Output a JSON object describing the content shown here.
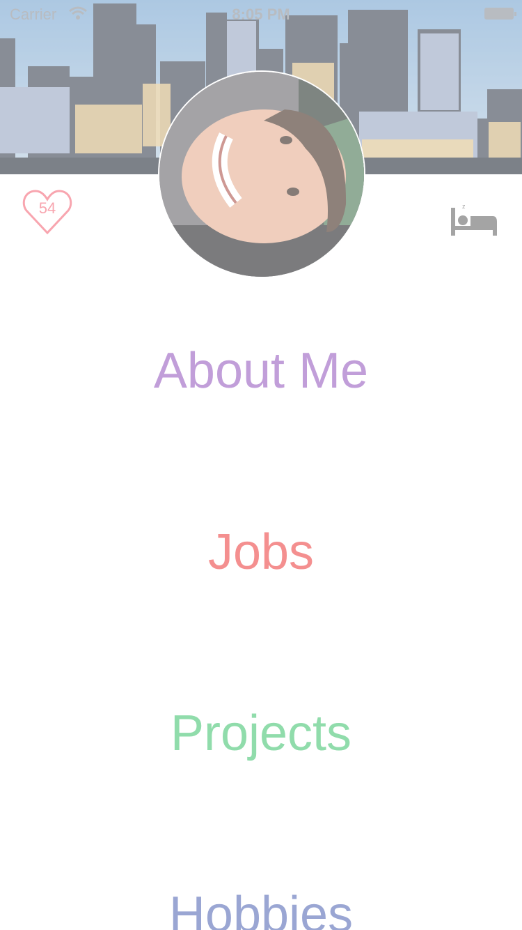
{
  "status_bar": {
    "carrier": "Carrier",
    "time": "8:05 PM"
  },
  "profile": {
    "like_count": "54",
    "like_color": "#f46f7e"
  },
  "menu": {
    "items": [
      {
        "label": "About Me",
        "color": "#9b63c2"
      },
      {
        "label": "Jobs",
        "color": "#ee4b4b"
      },
      {
        "label": "Projects",
        "color": "#4cc778"
      },
      {
        "label": "Hobbies",
        "color": "#5d70b9"
      }
    ]
  },
  "icons": {
    "like": "heart-icon",
    "sleep": "bed-icon",
    "signal": "wifi-icon",
    "power": "battery-icon"
  }
}
